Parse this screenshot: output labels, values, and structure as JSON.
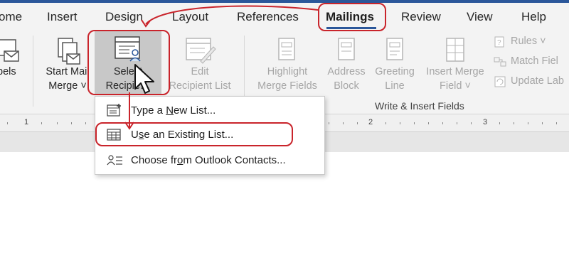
{
  "tabs": [
    "ome",
    "Insert",
    "Design",
    "Layout",
    "References",
    "Mailings",
    "Review",
    "View",
    "Help"
  ],
  "active_tab": "Mailings",
  "ribbon": {
    "labels_btn": "bels",
    "start_mail_merge": [
      "Start Mail",
      "Merge ˅"
    ],
    "select_recipients": [
      "Select",
      "Recipie…"
    ],
    "edit_recipient_list": [
      "Edit",
      "Recipient List"
    ],
    "highlight_merge_fields": [
      "Highlight",
      "Merge Fields"
    ],
    "address_block": [
      "Address",
      "Block"
    ],
    "greeting_line": [
      "Greeting",
      "Line"
    ],
    "insert_merge_field": [
      "Insert Merge",
      "Field ˅"
    ],
    "rules": "Rules ˅",
    "match_fields": "Match Fiel",
    "update_labels": "Update Lab",
    "group_write_insert": "Write & Insert Fields"
  },
  "ruler": {
    "numbers": [
      "1",
      "2",
      "3"
    ]
  },
  "dropdown": {
    "items": [
      {
        "pre": "Type a ",
        "accel": "N",
        "post": "ew List..."
      },
      {
        "pre": "U",
        "accel": "s",
        "post": "e an Existing List..."
      },
      {
        "pre": "Choose fr",
        "accel": "o",
        "post": "m Outlook Contacts..."
      }
    ]
  },
  "colors": {
    "accent": "#2b579a",
    "annotation": "#c9242b"
  },
  "icons": [
    "address-book-icon",
    "start-mail-merge-icon",
    "select-recipients-icon",
    "edit-list-icon",
    "field-document-icon",
    "rules-icon",
    "match-fields-icon",
    "update-labels-icon",
    "new-list-icon",
    "table-icon",
    "contacts-icon",
    "mouse-cursor-icon"
  ]
}
